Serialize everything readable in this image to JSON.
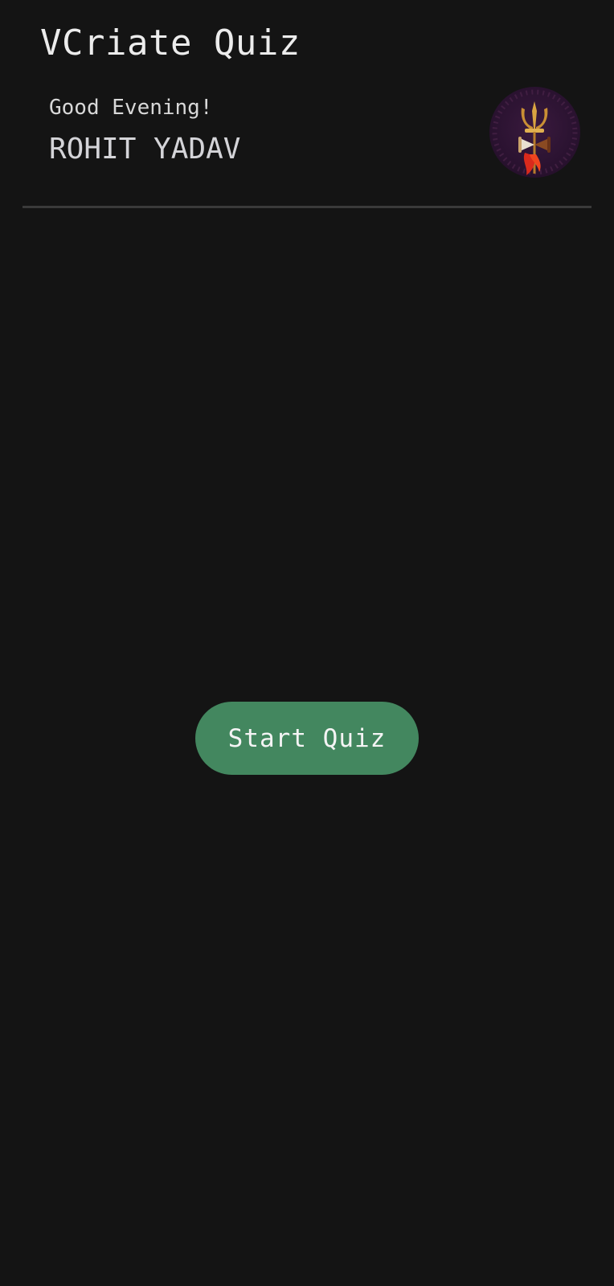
{
  "header": {
    "app_title": "VCriate Quiz"
  },
  "user": {
    "greeting": "Good Evening!",
    "name": "ROHIT YADAV",
    "avatar_icon": "trishul-damru-icon"
  },
  "main": {
    "start_button_label": "Start Quiz"
  },
  "colors": {
    "background": "#141414",
    "title_text": "#ececec",
    "divider": "#3a3a3a",
    "button_accent": "#43875f",
    "button_text": "#f4f4f4"
  }
}
